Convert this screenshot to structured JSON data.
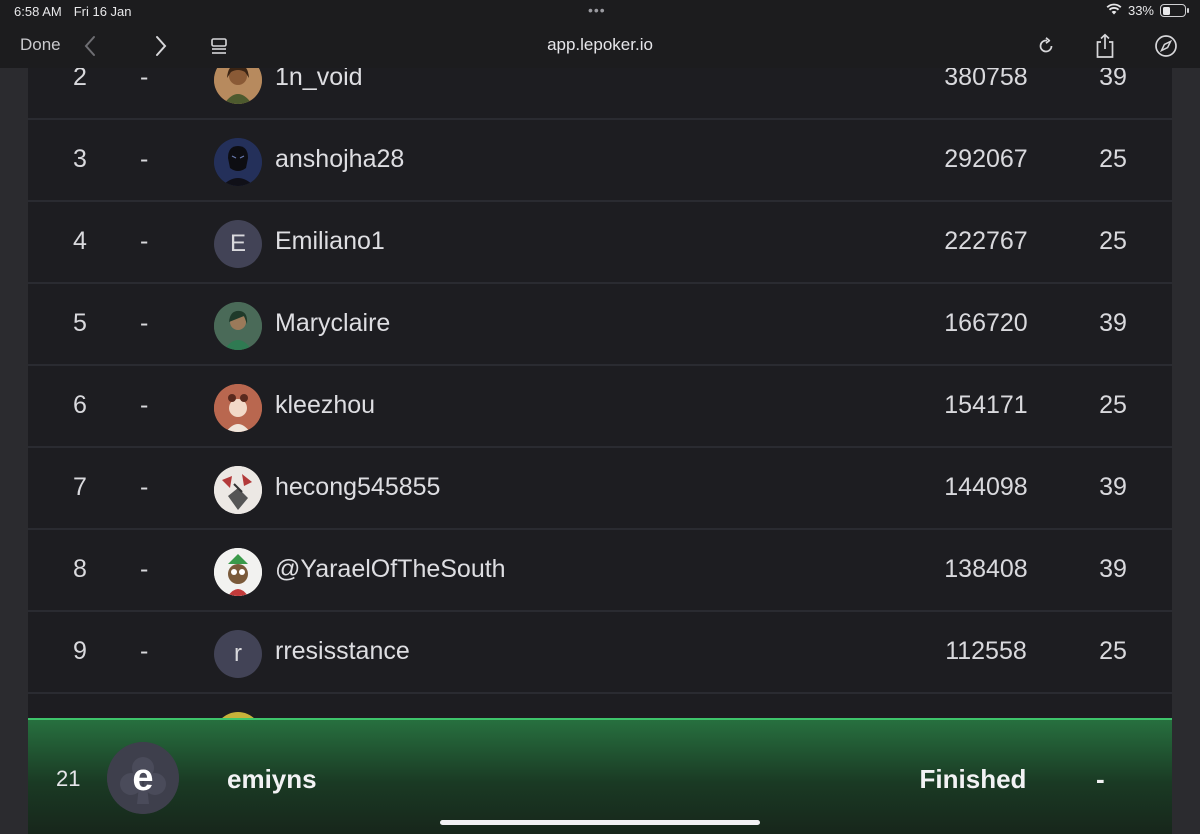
{
  "status_bar": {
    "time": "6:58 AM",
    "date": "Fri 16 Jan",
    "dots": "•••",
    "battery": "33%",
    "battery_level": 0.33
  },
  "browser": {
    "done_label": "Done",
    "url": "app.lepoker.io"
  },
  "leaderboard": {
    "rows": [
      {
        "rank": "2",
        "change": "-",
        "avatar": "photo",
        "name": "1n_void",
        "score": "380758",
        "count": "39"
      },
      {
        "rank": "3",
        "change": "-",
        "avatar": "photo",
        "name": "anshojha28",
        "score": "292067",
        "count": "25"
      },
      {
        "rank": "4",
        "change": "-",
        "avatar": "E",
        "name": "Emiliano1",
        "score": "222767",
        "count": "25"
      },
      {
        "rank": "5",
        "change": "-",
        "avatar": "photo",
        "name": "Maryclaire",
        "score": "166720",
        "count": "39"
      },
      {
        "rank": "6",
        "change": "-",
        "avatar": "photo",
        "name": "kleezhou",
        "score": "154171",
        "count": "25"
      },
      {
        "rank": "7",
        "change": "-",
        "avatar": "photo",
        "name": "hecong545855",
        "score": "144098",
        "count": "39"
      },
      {
        "rank": "8",
        "change": "-",
        "avatar": "photo",
        "name": "@YaraelOfTheSouth",
        "score": "138408",
        "count": "39"
      },
      {
        "rank": "9",
        "change": "-",
        "avatar": "r",
        "name": "rresisstance",
        "score": "112558",
        "count": "25"
      }
    ]
  },
  "current_user": {
    "rank": "21",
    "avatar_letter": "e",
    "name": "emiyns",
    "status": "Finished",
    "count": "-"
  },
  "colors": {
    "background": "#1d1d21",
    "footer_accent": "#3ec46b",
    "footer_bg": "#27703f"
  }
}
